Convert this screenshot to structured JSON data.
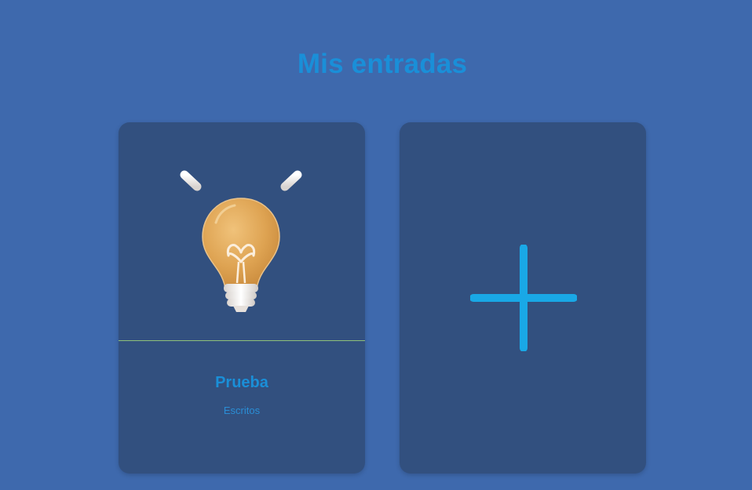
{
  "page": {
    "title": "Mis entradas"
  },
  "entries": [
    {
      "title": "Prueba",
      "category": "Escritos",
      "image_icon": "lightbulb-icon"
    }
  ],
  "add_card": {
    "icon": "plus-icon"
  },
  "colors": {
    "background": "#3e69ad",
    "card": "#32507f",
    "accent": "#1a8fd8",
    "plus": "#19a8e6",
    "divider": "#8fc07a"
  }
}
